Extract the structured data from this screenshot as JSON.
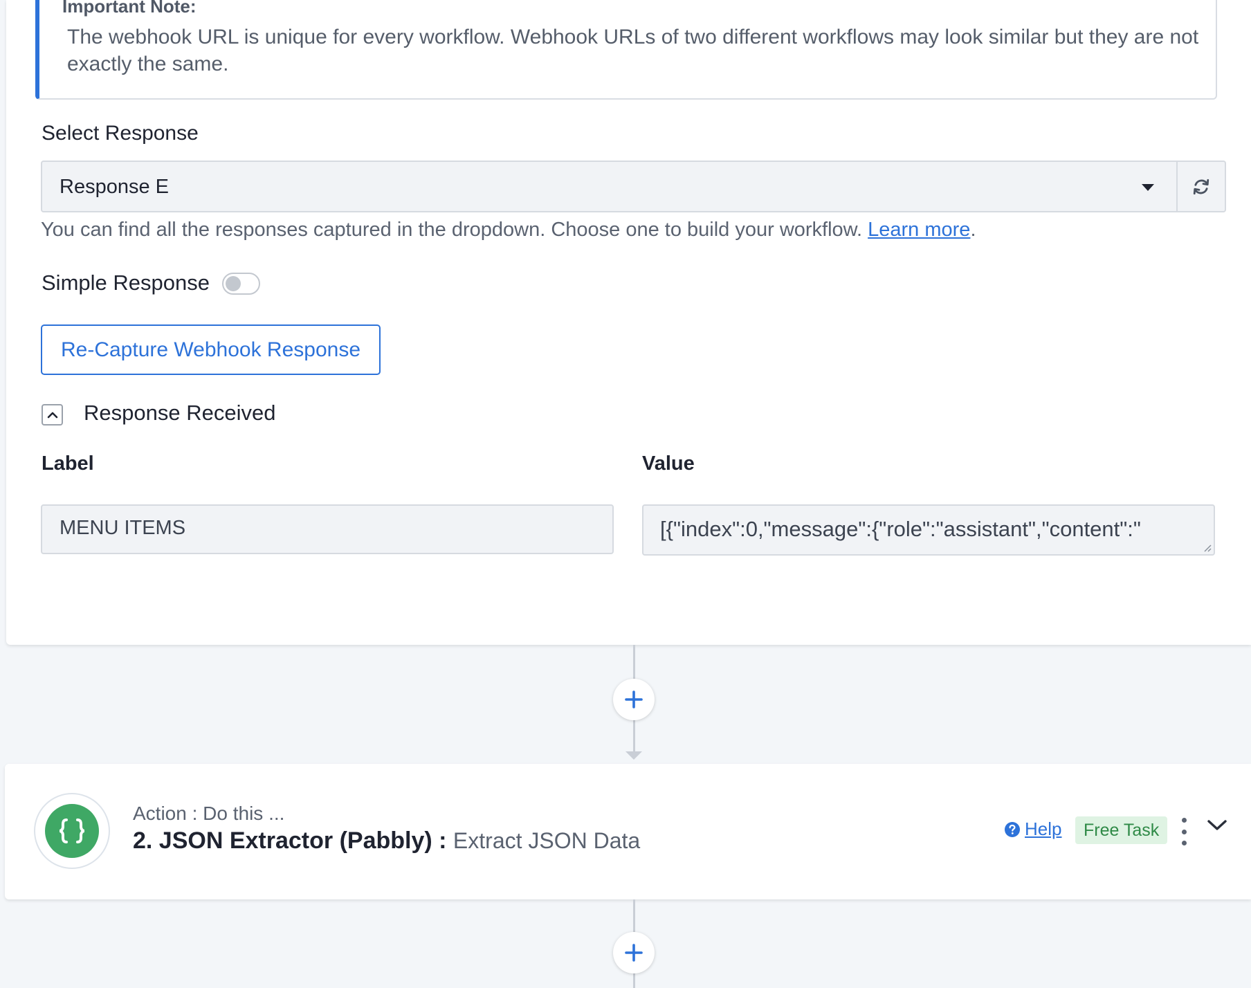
{
  "note": {
    "title": "Important Note:",
    "text": "The webhook URL is unique for every workflow. Webhook URLs of two different workflows may look similar but they are not exactly the same."
  },
  "select_response": {
    "label": "Select Response",
    "selected": "Response E",
    "helper_text": "You can find all the responses captured in the dropdown. Choose one to build your workflow.",
    "helper_link": "Learn more",
    "helper_suffix": "."
  },
  "simple_response": {
    "label": "Simple Response",
    "enabled": false
  },
  "recapture_button": "Re-Capture Webhook Response",
  "response_received": {
    "title": "Response Received",
    "expanded": true,
    "label_header": "Label",
    "value_header": "Value",
    "rows": [
      {
        "label": "MENU ITEMS",
        "value": "[{\"index\":0,\"message\":{\"role\":\"assistant\",\"content\":\""
      }
    ]
  },
  "action_step": {
    "subtitle": "Action : Do this ...",
    "title": "2. JSON Extractor (Pabbly) :",
    "event": "Extract JSON Data",
    "help": "Help",
    "badge": "Free Task",
    "icon": "curly-braces-icon"
  },
  "colors": {
    "accent": "#2d72d9",
    "app_icon": "#3fa865",
    "badge_bg": "#dff3e3",
    "badge_text": "#2f8a47"
  }
}
